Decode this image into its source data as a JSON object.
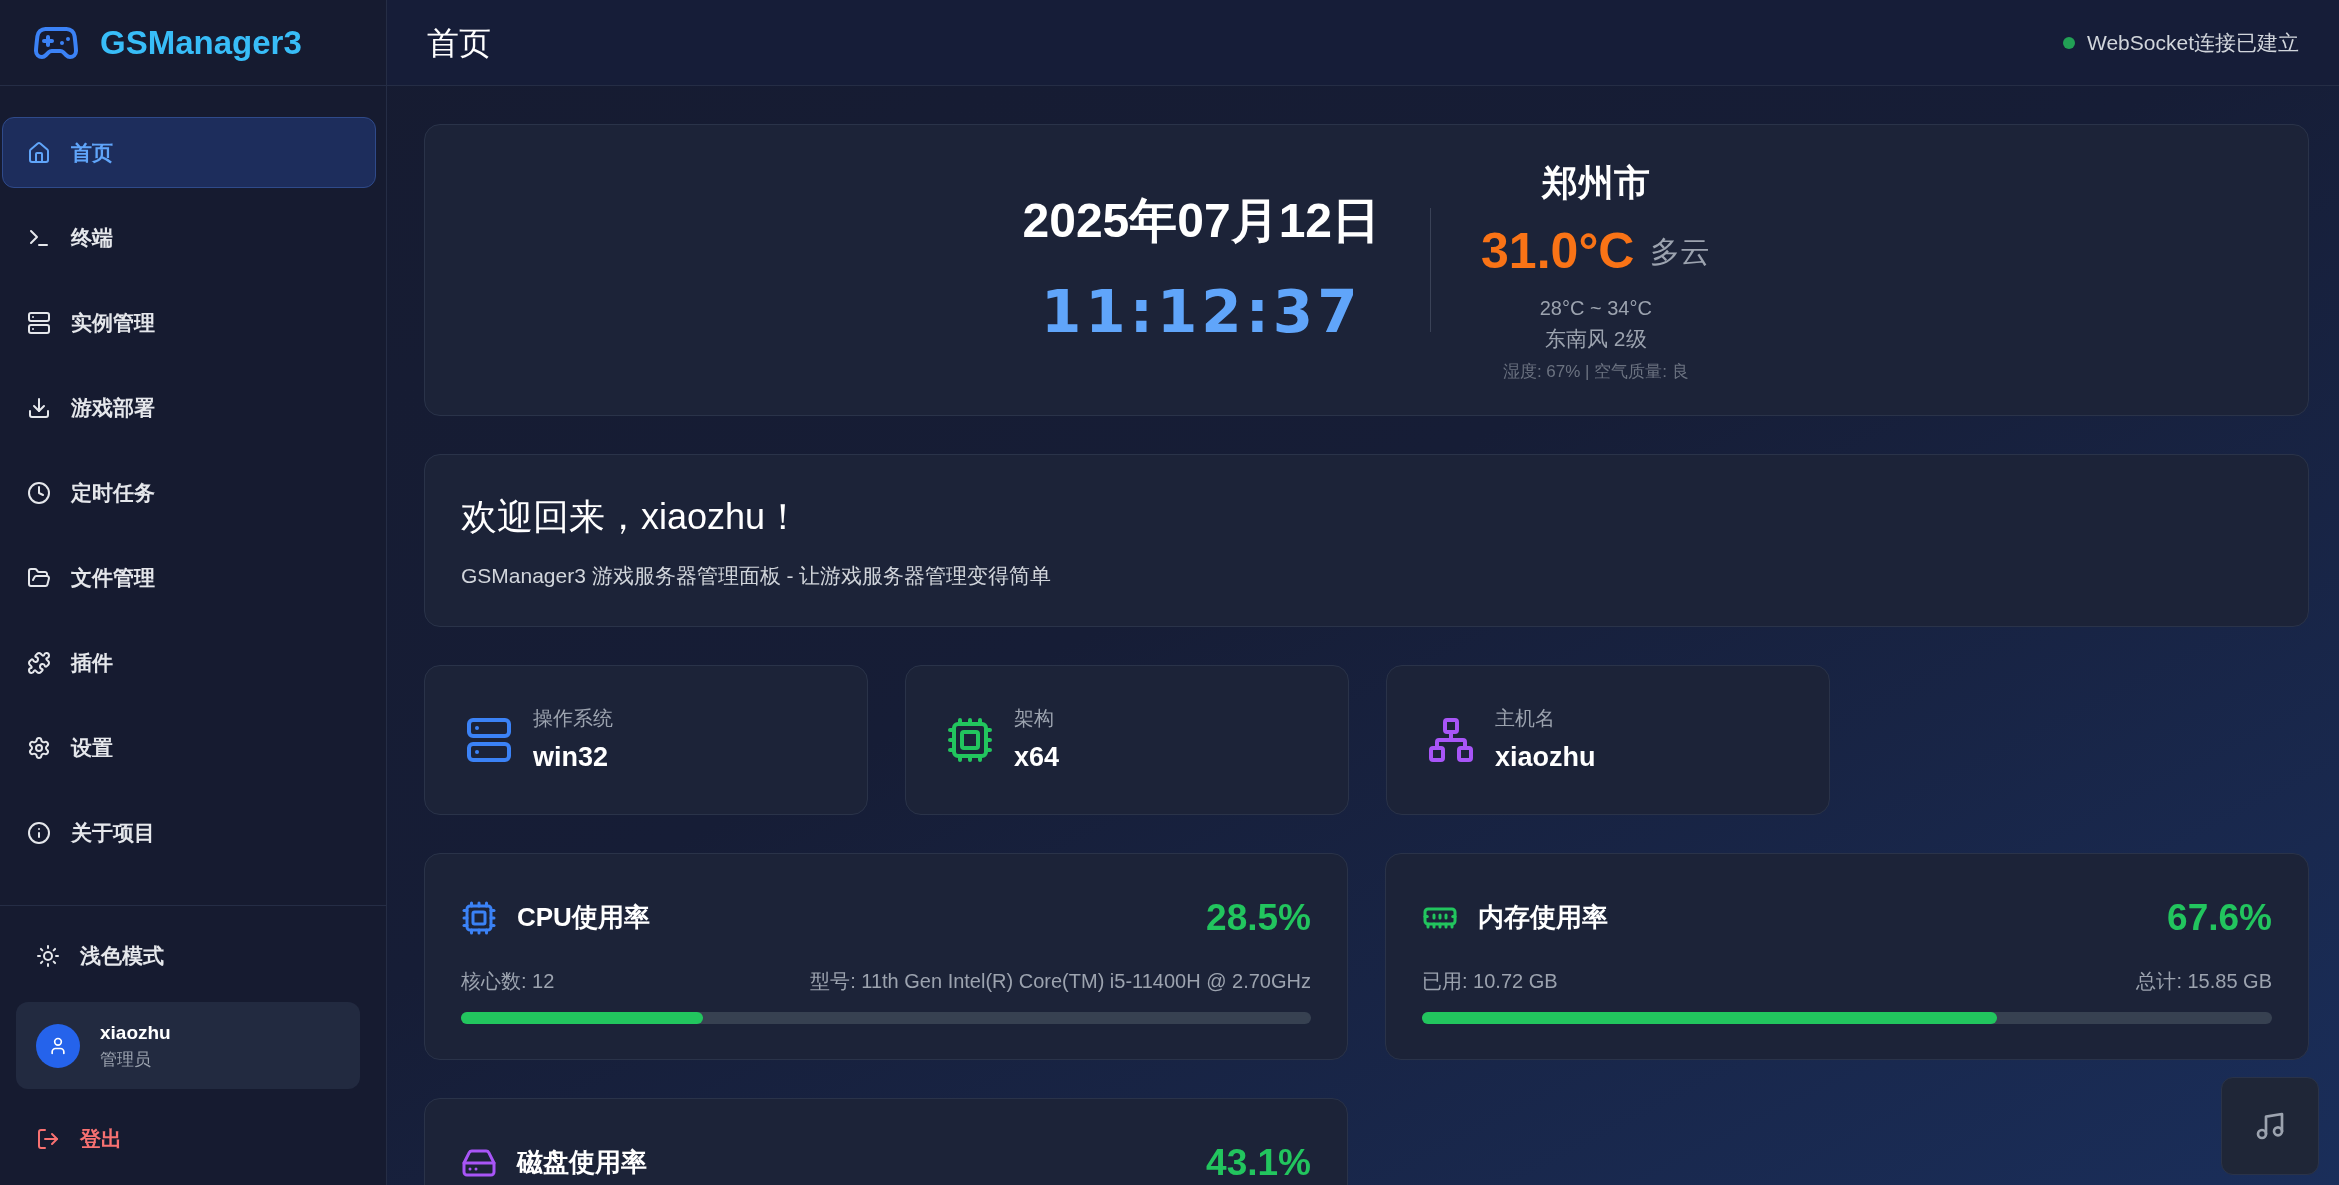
{
  "sidebar": {
    "brand": "GSManager3",
    "items": [
      {
        "label": "首页",
        "selected": true
      },
      {
        "label": "终端",
        "selected": false
      },
      {
        "label": "实例管理",
        "selected": false
      },
      {
        "label": "游戏部署",
        "selected": false
      },
      {
        "label": "定时任务",
        "selected": false
      },
      {
        "label": "文件管理",
        "selected": false
      },
      {
        "label": "插件",
        "selected": false
      },
      {
        "label": "设置",
        "selected": false
      },
      {
        "label": "关于项目",
        "selected": false
      }
    ],
    "theme_toggle": "浅色模式",
    "user": {
      "name": "xiaozhu",
      "role": "管理员"
    },
    "logout": "登出"
  },
  "header": {
    "title": "首页",
    "status": {
      "text": "WebSocket连接已建立",
      "connected": true
    }
  },
  "clock": {
    "date": "2025年07月12日",
    "time": "11:12:37"
  },
  "weather": {
    "city": "郑州市",
    "temperature": "31.0°C",
    "condition": "多云",
    "range": "28°C ~ 34°C",
    "wind": "东南风 2级",
    "details": "湿度: 67% | 空气质量: 良"
  },
  "welcome": {
    "title": "欢迎回来，xiaozhu！",
    "subtitle": "GSManager3 游戏服务器管理面板 - 让游戏服务器管理变得简单"
  },
  "system_info": [
    {
      "label": "操作系统",
      "value": "win32"
    },
    {
      "label": "架构",
      "value": "x64"
    },
    {
      "label": "主机名",
      "value": "xiaozhu"
    }
  ],
  "usage": [
    {
      "title": "CPU使用率",
      "value": "28.5%",
      "left": "核心数: 12",
      "right": "型号: 11th Gen Intel(R) Core(TM) i5-11400H @ 2.70GHz",
      "level": 0.285
    },
    {
      "title": "内存使用率",
      "value": "67.6%",
      "left": "已用: 10.72 GB",
      "right": "总计: 15.85 GB",
      "level": 0.676
    },
    {
      "title": "磁盘使用率",
      "value": "43.1%"
    }
  ]
}
